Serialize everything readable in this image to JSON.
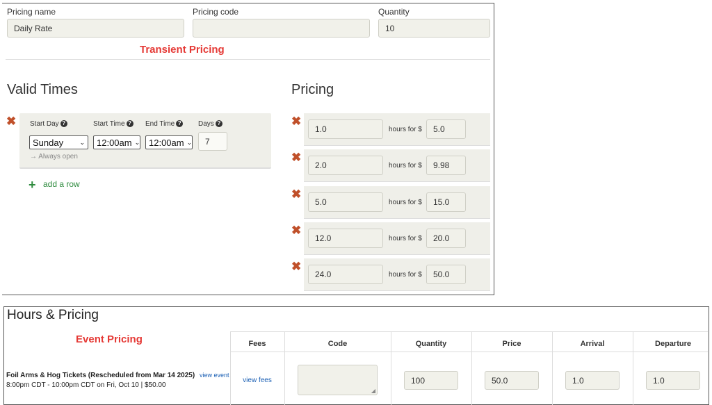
{
  "pricing_form": {
    "name_label": "Pricing name",
    "name_value": "Daily Rate",
    "code_label": "Pricing code",
    "code_value": "",
    "quantity_label": "Quantity",
    "quantity_value": "10"
  },
  "transient_heading": "Transient Pricing",
  "valid_times": {
    "title": "Valid Times",
    "start_day_label": "Start Day",
    "start_time_label": "Start Time",
    "end_time_label": "End Time",
    "days_label": "Days",
    "start_day_value": "Sunday",
    "start_time_value": "12:00am",
    "end_time_value": "12:00am",
    "days_value": "7",
    "note": "→ Always open",
    "add_row_label": "add a row"
  },
  "pricing": {
    "title": "Pricing",
    "hours_for_label": "hours for $",
    "rows": [
      {
        "hours": "1.0",
        "price": "5.0"
      },
      {
        "hours": "2.0",
        "price": "9.98"
      },
      {
        "hours": "5.0",
        "price": "15.0"
      },
      {
        "hours": "12.0",
        "price": "20.0"
      },
      {
        "hours": "24.0",
        "price": "50.0"
      }
    ]
  },
  "hours_pricing": {
    "title": "Hours & Pricing",
    "event_heading": "Event Pricing",
    "columns": [
      "Fees",
      "Code",
      "Quantity",
      "Price",
      "Arrival",
      "Departure"
    ],
    "event": {
      "name": "Foil Arms & Hog Tickets (Rescheduled from Mar 14 2025)",
      "view_event_link": "view event",
      "details": "8:00pm CDT - 10:00pm CDT on Fri, Oct 10 | $50.00",
      "fees_link": "view fees",
      "code": "",
      "quantity": "100",
      "price": "50.0",
      "arrival": "1.0",
      "departure": "1.0"
    }
  },
  "colors": {
    "accent_red": "#e53935",
    "delete_icon": "#c0502a",
    "add_green": "#2e8b3e",
    "link_blue": "#1a5fb4",
    "input_bg": "#f1f1ea"
  }
}
